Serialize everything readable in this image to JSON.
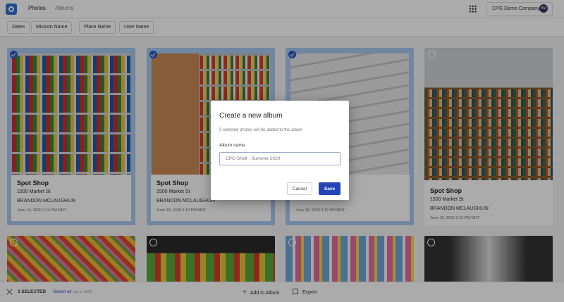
{
  "header": {
    "tabs": [
      "Photos",
      "Albums"
    ],
    "company": "CPG Demo Company",
    "avatar_initials": "BM"
  },
  "filters": [
    "Dates",
    "Mission Name",
    "Place Name",
    "User Name"
  ],
  "cards": [
    {
      "place": "Spot Shop",
      "address": "1500 Market St",
      "user": "BRANDON MCLAUGHLIN",
      "date": "June 19, 2020 2:14 PM MDT",
      "selected": true
    },
    {
      "place": "Spot Shop",
      "address": "1500 Market St",
      "user": "BRANDON MCLAUGHLIN",
      "date": "June 19, 2020 2:12 PM MDT",
      "selected": true
    },
    {
      "place": "",
      "address": "",
      "user": "",
      "date": "June 19, 2020 2:12 PM MDT",
      "selected": true
    },
    {
      "place": "Spot Shop",
      "address": "1500 Market St",
      "user": "BRANDON MCLAUGHLIN",
      "date": "June 19, 2020 2:12 PM MDT",
      "selected": false
    }
  ],
  "bottom_bar": {
    "selected_label": "3 SELECTED",
    "select_all": "Select all",
    "select_all_hint": "(up to 1000)",
    "add_to_album": "Add to Album",
    "export": "Export"
  },
  "modal": {
    "title": "Create a new album",
    "subtitle": "3 selected photos will be added to the album",
    "field_label": "Album name",
    "field_value": "CPG Shelf - Summer 2020",
    "cancel": "Cancel",
    "save": "Save"
  },
  "colors": {
    "accent": "#2444b8",
    "selected_card": "#a9c8f0",
    "check": "#2b59c3"
  }
}
